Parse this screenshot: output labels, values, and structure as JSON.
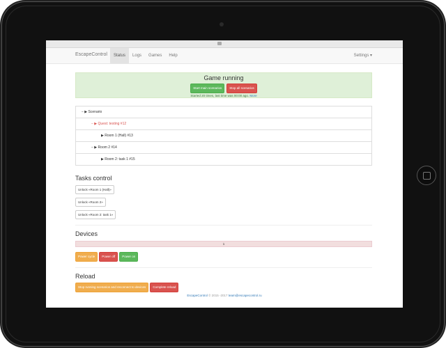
{
  "navbar": {
    "brand": "EscapeControl",
    "items": [
      {
        "label": "Status",
        "active": true
      },
      {
        "label": "Logs",
        "active": false
      },
      {
        "label": "Games",
        "active": false
      },
      {
        "label": "Help",
        "active": false
      }
    ],
    "settings_label": "Settings ▾"
  },
  "status": {
    "title": "Game running",
    "start_button": "Start main scenarios",
    "stop_button": "Stop all scenarios",
    "info_text": "Started 20 times, last time was 00:00 ago.",
    "more_link": "More"
  },
  "tree": [
    {
      "prefix": "− ▶",
      "label": "Scenario",
      "indent": 0,
      "red": false
    },
    {
      "prefix": "− ▶",
      "label": "Quest: testing #12",
      "indent": 1,
      "red": true
    },
    {
      "prefix": "▶",
      "label": "Room 1 (Hall) #13",
      "indent": 2,
      "red": false
    },
    {
      "prefix": "− ▶",
      "label": "Room 2 #14",
      "indent": 1,
      "red": false
    },
    {
      "prefix": "▶",
      "label": "Room 2: task 1 #15",
      "indent": 2,
      "red": false
    }
  ],
  "tasks": {
    "heading": "Tasks control",
    "buttons": [
      "Unlock «Room 1 (Hall)»",
      "Unlock «Room 2»",
      "Unlock «Room 2: task 1»"
    ]
  },
  "devices": {
    "heading": "Devices",
    "progress_text": "1",
    "buttons": {
      "cycle": "Power cycle",
      "off": "Power off",
      "on": "Power on"
    }
  },
  "reload": {
    "heading": "Reload",
    "stop_reconnect": "Stop running scenarios and reconnect to devices",
    "complete": "Complete reload"
  },
  "footer": {
    "brand": "EscapeControl",
    "years": "© 2015 -2017",
    "email": "team@escapecontrol.ru"
  }
}
